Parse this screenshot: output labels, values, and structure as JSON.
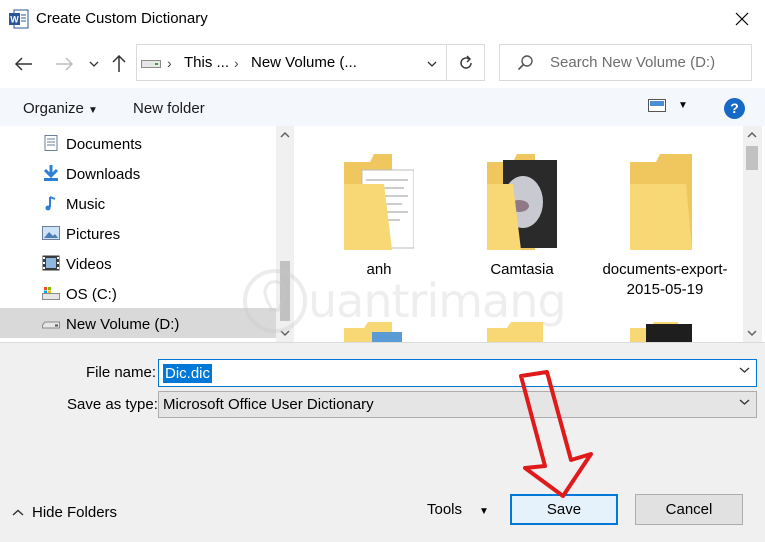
{
  "window": {
    "title": "Create Custom Dictionary"
  },
  "address": {
    "crumbs": [
      "This ...",
      "New Volume (..."
    ]
  },
  "search": {
    "placeholder": "Search New Volume (D:)"
  },
  "toolbar": {
    "organize": "Organize",
    "new_folder": "New folder",
    "help": "?"
  },
  "nav": {
    "items": [
      {
        "label": "Documents",
        "icon": "documents-icon"
      },
      {
        "label": "Downloads",
        "icon": "downloads-icon"
      },
      {
        "label": "Music",
        "icon": "music-icon"
      },
      {
        "label": "Pictures",
        "icon": "pictures-icon"
      },
      {
        "label": "Videos",
        "icon": "videos-icon"
      },
      {
        "label": "OS (C:)",
        "icon": "drive-c-icon"
      },
      {
        "label": "New Volume (D:)",
        "icon": "drive-d-icon",
        "selected": true
      }
    ]
  },
  "files": {
    "items": [
      {
        "name": "anh"
      },
      {
        "name": "Camtasia"
      },
      {
        "name": "documents-export-2015-05-19"
      }
    ]
  },
  "form": {
    "file_name_label": "File name:",
    "file_name_value": "Dic.dic",
    "save_type_label": "Save as type:",
    "save_type_value": "Microsoft Office User Dictionary"
  },
  "footer": {
    "hide_folders": "Hide Folders",
    "tools": "Tools",
    "save": "Save",
    "cancel": "Cancel"
  },
  "watermark": {
    "text": "uantrimang"
  },
  "colors": {
    "accent": "#0078d7",
    "folder": "#f8d775",
    "annotation_arrow": "#e0191b"
  }
}
